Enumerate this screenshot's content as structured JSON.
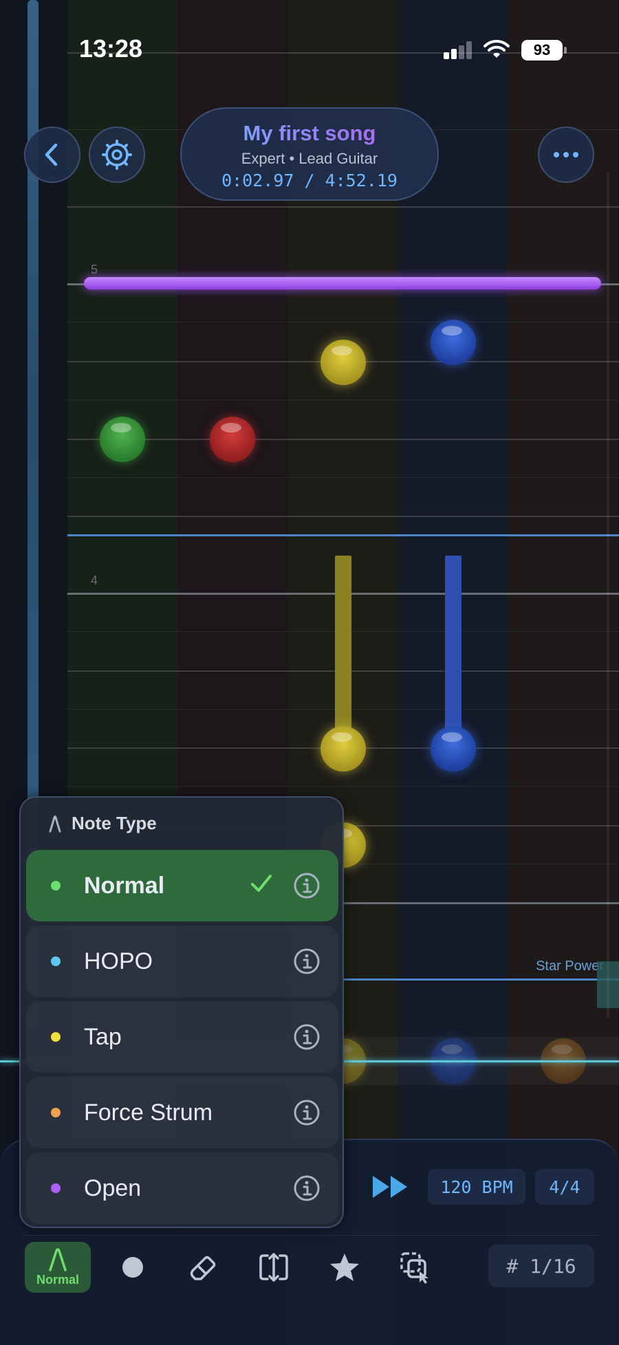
{
  "status_bar": {
    "time": "13:28",
    "battery": "93"
  },
  "header": {
    "back_icon": "chevron-left-icon",
    "settings_icon": "gear-icon",
    "more_icon": "ellipsis-icon",
    "song_title": "My first song",
    "song_subtitle": "Expert • Lead Guitar",
    "time_display": "0:02.97 / 4:52.19"
  },
  "highway": {
    "measure_labels": [
      "5",
      "4"
    ],
    "star_power_label": "Star Power",
    "lane_colors": [
      "#2a7d2c",
      "#931f1f",
      "#a59420",
      "#1e3f9e",
      "#7c4b18"
    ],
    "accent_color": "#5fc8d8"
  },
  "note_type_menu": {
    "title": "Note Type",
    "selected": "Normal",
    "options": [
      {
        "label": "Normal",
        "color": "#6ede6e"
      },
      {
        "label": "HOPO",
        "color": "#5cc8f0"
      },
      {
        "label": "Tap",
        "color": "#f0e040"
      },
      {
        "label": "Force Strum",
        "color": "#f0a050"
      },
      {
        "label": "Open",
        "color": "#b060f0"
      }
    ]
  },
  "transport": {
    "fast_forward_icon": "fast-forward-icon",
    "bpm": "120 BPM",
    "time_signature": "4/4"
  },
  "tools": {
    "active_label": "Normal",
    "icons": [
      "note-type-icon",
      "circle-note-icon",
      "eraser-icon",
      "move-icon",
      "star-icon",
      "select-copy-icon"
    ]
  },
  "measure_counter": "# 1/16"
}
